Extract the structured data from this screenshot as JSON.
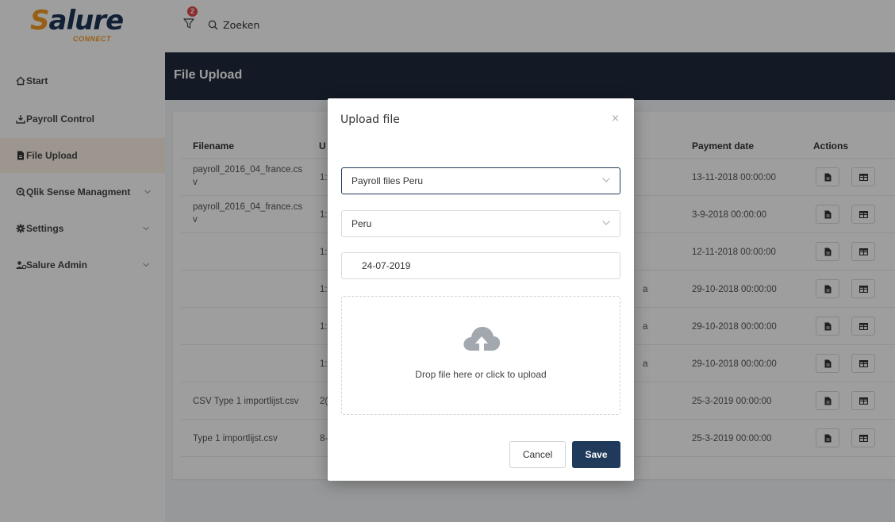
{
  "app": {
    "logo_text": "alure",
    "logo_initial": "S",
    "logo_sub": "CONNECT",
    "filter_badge": "2",
    "search_placeholder": "Zoeken"
  },
  "sidebar": {
    "items": [
      {
        "label": "Start",
        "icon": "home-icon"
      },
      {
        "label": "Payroll Control",
        "icon": "download-icon"
      },
      {
        "label": "File Upload",
        "icon": "file-icon",
        "active": true
      },
      {
        "label": "Qlik Sense Managment",
        "icon": "qlik-icon",
        "expandable": true
      },
      {
        "label": "Settings",
        "icon": "gear-icon",
        "expandable": true
      },
      {
        "label": "Salure Admin",
        "icon": "users-icon",
        "expandable": true
      }
    ]
  },
  "main": {
    "title": "File Upload",
    "table": {
      "columns": [
        "Filename",
        "U",
        "Payment date",
        "Actions"
      ],
      "rows": [
        {
          "filename": "payroll_2016_04_france.cs\nv",
          "u": "1:",
          "mid": "",
          "payment_date": "13-11-2018 00:00:00"
        },
        {
          "filename": "payroll_2016_04_france.cs\nv",
          "u": "1:",
          "mid": "",
          "payment_date": "3-9-2018 00:00:00"
        },
        {
          "filename": "",
          "u": "1:",
          "mid": "",
          "payment_date": "12-11-2018 00:00:00"
        },
        {
          "filename": "",
          "u": "1:",
          "mid": "a",
          "payment_date": "29-10-2018 00:00:00"
        },
        {
          "filename": "",
          "u": "1:",
          "mid": "a",
          "payment_date": "29-10-2018 00:00:00"
        },
        {
          "filename": "",
          "u": "1:",
          "mid": "a",
          "payment_date": "29-10-2018 00:00:00"
        },
        {
          "filename": "CSV Type 1 importlijst.csv",
          "u": "2(",
          "mid": "",
          "payment_date": "25-3-2019 00:00:00"
        },
        {
          "filename": "Type 1 importlijst.csv",
          "u": "8-",
          "mid": "",
          "payment_date": "25-3-2019 00:00:00"
        }
      ]
    }
  },
  "modal": {
    "title": "Upload file",
    "close": "×",
    "file_type": "Payroll files Peru",
    "country": "Peru",
    "date": "24-07-2019",
    "drop_text": "Drop file here or click to upload",
    "cancel_label": "Cancel",
    "save_label": "Save"
  },
  "colors": {
    "brand_navy": "#1d3557",
    "brand_orange": "#f29a1f",
    "header_dark": "#1f2a3c",
    "save_button": "#1f3a5a",
    "badge_red": "#e0474c"
  }
}
